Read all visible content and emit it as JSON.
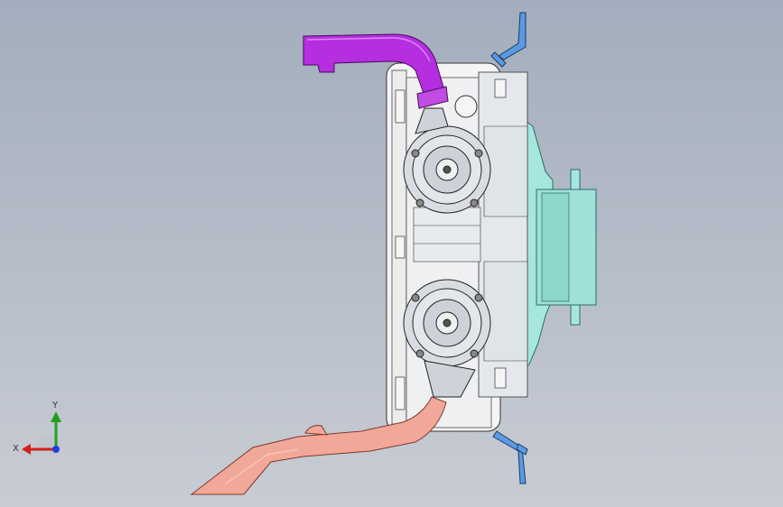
{
  "viewport": {
    "background_top": "#a3adbd",
    "background_bottom": "#c8ccd4"
  },
  "model": {
    "parts": [
      {
        "name": "upper-intake-duct",
        "color": "#b026d6"
      },
      {
        "name": "lower-outlet-duct",
        "color": "#f0a593"
      },
      {
        "name": "mounting-frame",
        "color": "#f4f4f4"
      },
      {
        "name": "rear-housing",
        "color": "#9fe0d8"
      },
      {
        "name": "blower-assembly-upper",
        "color": "#c9ced6"
      },
      {
        "name": "blower-assembly-lower",
        "color": "#c9ced6"
      },
      {
        "name": "mounting-bracket-top",
        "color": "#4a8fd6"
      },
      {
        "name": "mounting-bracket-bottom",
        "color": "#4a8fd6"
      }
    ]
  },
  "triad": {
    "x_label": "X",
    "y_label": "Y",
    "x_color": "#d42020",
    "y_color": "#1ea01e",
    "z_color": "#1f3fd6"
  }
}
